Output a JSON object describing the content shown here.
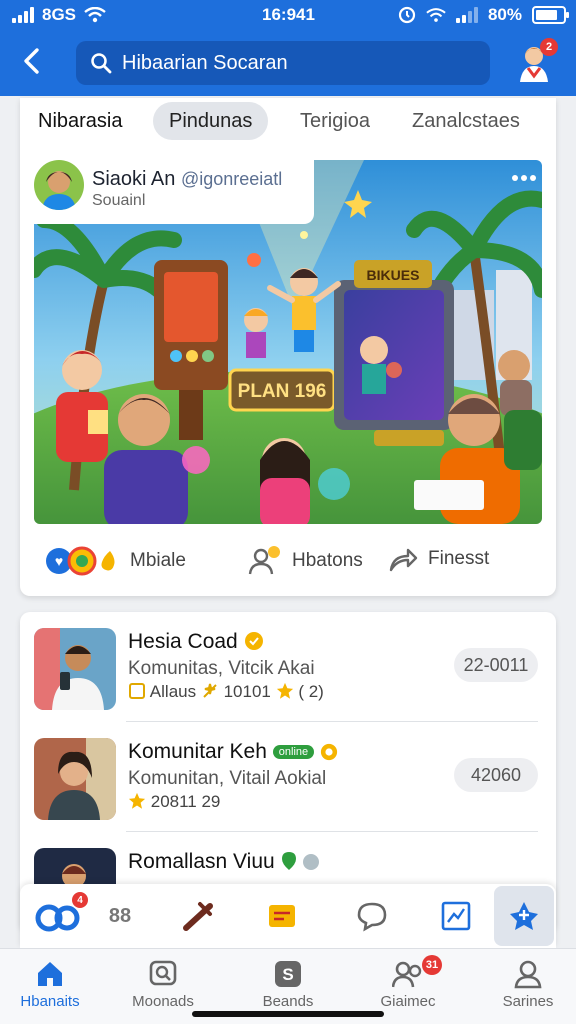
{
  "status_bar": {
    "carrier": "8GS",
    "time": "16:941",
    "battery": "80%",
    "battery_level": 0.8
  },
  "search": {
    "placeholder": "Hibaarian Socaran"
  },
  "notifications": {
    "count": "2"
  },
  "tabs": [
    {
      "label": "Nibarasia"
    },
    {
      "label": "Pindunas",
      "selected": true
    },
    {
      "label": "Terigioa"
    },
    {
      "label": "Zanalcstaes"
    }
  ],
  "post": {
    "author": "Siaoki An",
    "handle": "@igonreeiatl",
    "subtitle": "Souainl",
    "image_sign": "PLAN 196",
    "image_banner": "BIKUES",
    "actions": [
      {
        "label": "Mbiale",
        "icon": "reaction-icons"
      },
      {
        "label": "Hbatons",
        "icon": "people-icon"
      },
      {
        "label": "Finesst",
        "icon": "share-icon"
      }
    ]
  },
  "communities": [
    {
      "title": "Hesia Coad",
      "desc": "Komunitas, Vitcik Akai",
      "meta": "Allaus",
      "meta2": "10101",
      "rating": "( 2)",
      "pill": "22-0011"
    },
    {
      "title": "Komunitar Keh",
      "tag": "online",
      "desc": "Komunitan, Vitail Aokial",
      "meta": "20811 29",
      "pill": "42060"
    },
    {
      "title": "Romallasn Viuu",
      "desc": "",
      "meta": "",
      "pill": ""
    }
  ],
  "toolbar": {
    "badge": "4",
    "count_label": "88"
  },
  "bottom_nav": [
    {
      "label": "Hbanaits",
      "icon": "home-icon",
      "active": true
    },
    {
      "label": "Moonads",
      "icon": "chat-search-icon"
    },
    {
      "label": "Beands",
      "icon": "brand-icon"
    },
    {
      "label": "Giaimec",
      "icon": "group-icon",
      "badge": "31"
    },
    {
      "label": "Sarines",
      "icon": "profile-icon"
    }
  ],
  "colors": {
    "primary": "#1e6fdc",
    "badge": "#e53935",
    "star": "#f5b400"
  }
}
